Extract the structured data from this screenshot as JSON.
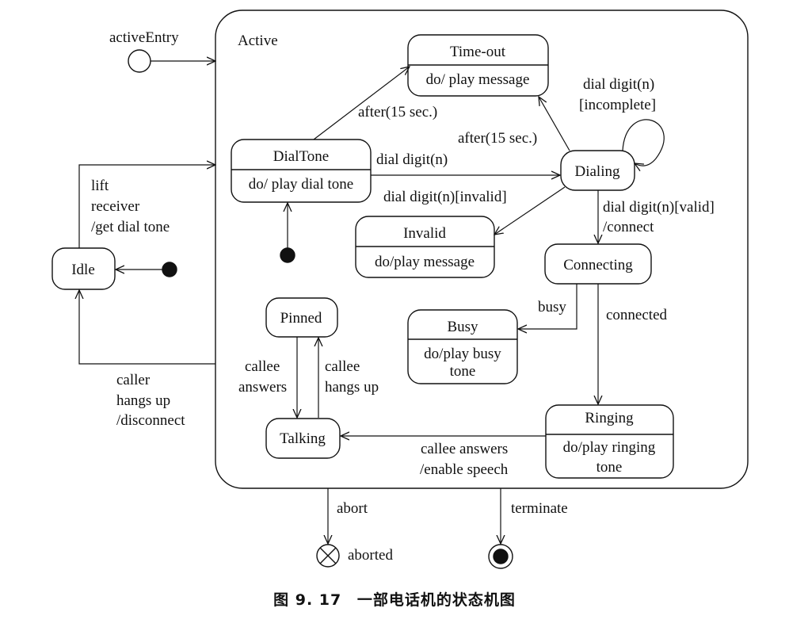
{
  "diagram": {
    "composite_label": "Active",
    "pseudo": {
      "active_entry": "activeEntry",
      "aborted": "aborted"
    },
    "states": {
      "time_out": {
        "name": "Time-out",
        "activity": "do/ play message"
      },
      "dial_tone": {
        "name": "DialTone",
        "activity": "do/ play dial tone"
      },
      "dialing": {
        "name": "Dialing"
      },
      "invalid": {
        "name": "Invalid",
        "activity": "do/play message"
      },
      "connecting": {
        "name": "Connecting"
      },
      "busy": {
        "name": "Busy",
        "activity_line1": "do/play busy",
        "activity_line2": "tone"
      },
      "ringing": {
        "name": "Ringing",
        "activity_line1": "do/play ringing",
        "activity_line2": "tone"
      },
      "pinned": {
        "name": "Pinned"
      },
      "talking": {
        "name": "Talking"
      },
      "idle": {
        "name": "Idle"
      }
    },
    "transitions": {
      "dialtone_timeout": "after(15 sec.)",
      "dialing_timeout": "after(15 sec.)",
      "dialing_self_1": "dial digit(n)",
      "dialing_self_2": "[incomplete]",
      "dialtone_dialing": "dial digit(n)",
      "dialing_invalid": "dial digit(n)[invalid]",
      "dialing_connecting_1": "dial digit(n)[valid]",
      "dialing_connecting_2": "/connect",
      "connecting_busy": "busy",
      "connecting_ringing": "connected",
      "ringing_talking_1": "callee answers",
      "ringing_talking_2": "/enable speech",
      "pinned_talking_1": "callee",
      "pinned_talking_2": "answers",
      "talking_pinned_1": "callee",
      "talking_pinned_2": "hangs up",
      "idle_active_1": "lift",
      "idle_active_2": "receiver",
      "idle_active_3": "/get dial tone",
      "active_idle_1": "caller",
      "active_idle_2": "hangs up",
      "active_idle_3": "/disconnect",
      "abort": "abort",
      "terminate": "terminate"
    }
  },
  "caption": {
    "figure_no": "图 9. 17",
    "title": "一部电话机的状态机图"
  }
}
